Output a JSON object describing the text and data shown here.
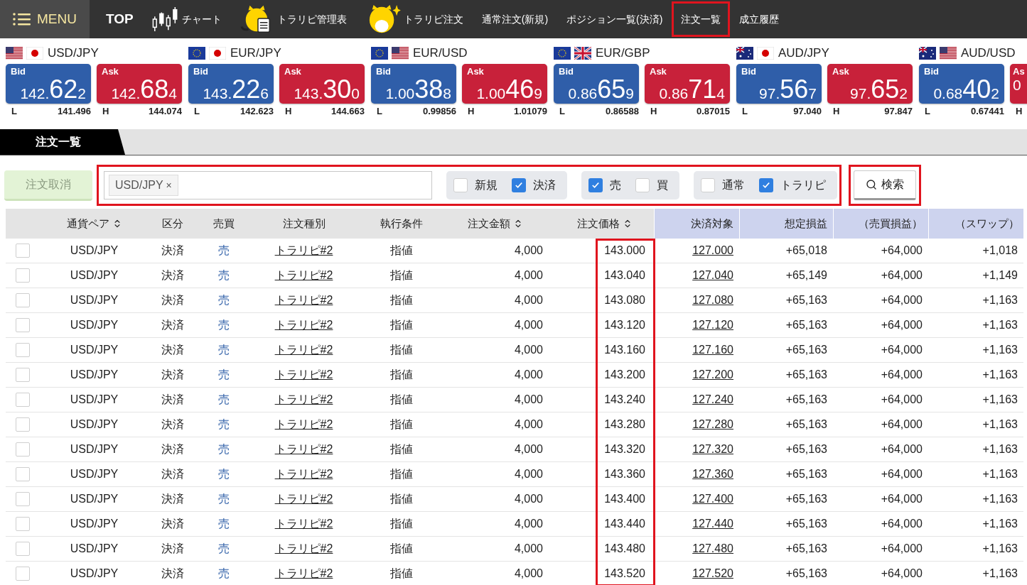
{
  "nav": {
    "items": [
      {
        "kind": "menu",
        "label": "MENU",
        "highlighted": false
      },
      {
        "kind": "bold",
        "label": "TOP",
        "highlighted": false
      },
      {
        "kind": "chart",
        "label": "チャート",
        "highlighted": false
      },
      {
        "kind": "tiger-sheet",
        "label": "トラリピ管理表",
        "highlighted": false
      },
      {
        "kind": "tiger",
        "label": "トラリピ注文",
        "highlighted": false
      },
      {
        "kind": "text",
        "label": "通常注文(新規)",
        "highlighted": false
      },
      {
        "kind": "text",
        "label": "ポジション一覧(決済)",
        "highlighted": false
      },
      {
        "kind": "text",
        "label": "注文一覧",
        "highlighted": true
      },
      {
        "kind": "text",
        "label": "成立履歴",
        "highlighted": false
      }
    ]
  },
  "quotes": [
    {
      "pair": "USD/JPY",
      "bid": {
        "label": "Bid",
        "prefix": "142.",
        "big": "62",
        "small": "2"
      },
      "ask": {
        "label": "Ask",
        "prefix": "142.",
        "big": "68",
        "small": "4"
      },
      "low_label": "L",
      "low": "141.496",
      "high_label": "H",
      "high": "144.074"
    },
    {
      "pair": "EUR/JPY",
      "bid": {
        "label": "Bid",
        "prefix": "143.",
        "big": "22",
        "small": "6"
      },
      "ask": {
        "label": "Ask",
        "prefix": "143.",
        "big": "30",
        "small": "0"
      },
      "low_label": "L",
      "low": "142.623",
      "high_label": "H",
      "high": "144.663"
    },
    {
      "pair": "EUR/USD",
      "bid": {
        "label": "Bid",
        "prefix": "1.00",
        "big": "38",
        "small": "8"
      },
      "ask": {
        "label": "Ask",
        "prefix": "1.00",
        "big": "46",
        "small": "9"
      },
      "low_label": "L",
      "low": "0.99856",
      "high_label": "H",
      "high": "1.01079"
    },
    {
      "pair": "EUR/GBP",
      "bid": {
        "label": "Bid",
        "prefix": "0.86",
        "big": "65",
        "small": "9"
      },
      "ask": {
        "label": "Ask",
        "prefix": "0.86",
        "big": "71",
        "small": "4"
      },
      "low_label": "L",
      "low": "0.86588",
      "high_label": "H",
      "high": "0.87015"
    },
    {
      "pair": "AUD/JPY",
      "bid": {
        "label": "Bid",
        "prefix": "97.",
        "big": "56",
        "small": "7"
      },
      "ask": {
        "label": "Ask",
        "prefix": "97.",
        "big": "65",
        "small": "2"
      },
      "low_label": "L",
      "low": "97.040",
      "high_label": "H",
      "high": "97.847"
    },
    {
      "pair": "AUD/USD",
      "bid": {
        "label": "Bid",
        "prefix": "0.68",
        "big": "40",
        "small": "2"
      },
      "ask": {
        "label": "As",
        "prefix": "0"
      },
      "low_label": "L",
      "low": "0.67441",
      "high_label": "H"
    }
  ],
  "tab": {
    "label": "注文一覧",
    "selected": true
  },
  "toolbar": {
    "cancel_button": {
      "label": "注文取消",
      "disabled": true
    },
    "filters": {
      "highlighted": true,
      "tag": {
        "label": "USD/JPY",
        "remove": "×"
      },
      "groups": [
        [
          {
            "label": "新規",
            "checked": false
          },
          {
            "label": "決済",
            "checked": true
          }
        ],
        [
          {
            "label": "売",
            "checked": true
          },
          {
            "label": "買",
            "checked": false
          }
        ],
        [
          {
            "label": "通常",
            "checked": false
          },
          {
            "label": "トラリピ",
            "checked": true
          }
        ]
      ]
    },
    "search_button": {
      "label": "検索",
      "highlighted": true
    }
  },
  "table": {
    "price_column_highlighted": true,
    "columns": [
      {
        "label": "通貨ペア",
        "sortable": true,
        "kind": "order"
      },
      {
        "label": "区分",
        "sortable": false,
        "kind": "order"
      },
      {
        "label": "売買",
        "sortable": false,
        "kind": "order"
      },
      {
        "label": "注文種別",
        "sortable": false,
        "kind": "order"
      },
      {
        "label": "執行条件",
        "sortable": false,
        "kind": "order"
      },
      {
        "label": "注文金額",
        "sortable": true,
        "kind": "order"
      },
      {
        "label": "注文価格",
        "sortable": true,
        "kind": "order"
      },
      {
        "label": "決済対象",
        "sortable": false,
        "kind": "settlement"
      },
      {
        "label": "想定損益",
        "sortable": false,
        "kind": "settlement"
      },
      {
        "label": "（売買損益）",
        "sortable": false,
        "kind": "settlement"
      },
      {
        "label": "（スワップ）",
        "sortable": false,
        "kind": "settlement"
      }
    ],
    "rows": [
      {
        "checked": false,
        "cells": [
          "USD/JPY",
          "決済",
          "売",
          "トラリピ#2",
          "指値",
          "4,000",
          "143.000",
          "127.000",
          "+65,018",
          "+64,000",
          "+1,018"
        ]
      },
      {
        "checked": false,
        "cells": [
          "USD/JPY",
          "決済",
          "売",
          "トラリピ#2",
          "指値",
          "4,000",
          "143.040",
          "127.040",
          "+65,149",
          "+64,000",
          "+1,149"
        ]
      },
      {
        "checked": false,
        "cells": [
          "USD/JPY",
          "決済",
          "売",
          "トラリピ#2",
          "指値",
          "4,000",
          "143.080",
          "127.080",
          "+65,163",
          "+64,000",
          "+1,163"
        ]
      },
      {
        "checked": false,
        "cells": [
          "USD/JPY",
          "決済",
          "売",
          "トラリピ#2",
          "指値",
          "4,000",
          "143.120",
          "127.120",
          "+65,163",
          "+64,000",
          "+1,163"
        ]
      },
      {
        "checked": false,
        "cells": [
          "USD/JPY",
          "決済",
          "売",
          "トラリピ#2",
          "指値",
          "4,000",
          "143.160",
          "127.160",
          "+65,163",
          "+64,000",
          "+1,163"
        ]
      },
      {
        "checked": false,
        "cells": [
          "USD/JPY",
          "決済",
          "売",
          "トラリピ#2",
          "指値",
          "4,000",
          "143.200",
          "127.200",
          "+65,163",
          "+64,000",
          "+1,163"
        ]
      },
      {
        "checked": false,
        "cells": [
          "USD/JPY",
          "決済",
          "売",
          "トラリピ#2",
          "指値",
          "4,000",
          "143.240",
          "127.240",
          "+65,163",
          "+64,000",
          "+1,163"
        ]
      },
      {
        "checked": false,
        "cells": [
          "USD/JPY",
          "決済",
          "売",
          "トラリピ#2",
          "指値",
          "4,000",
          "143.280",
          "127.280",
          "+65,163",
          "+64,000",
          "+1,163"
        ]
      },
      {
        "checked": false,
        "cells": [
          "USD/JPY",
          "決済",
          "売",
          "トラリピ#2",
          "指値",
          "4,000",
          "143.320",
          "127.320",
          "+65,163",
          "+64,000",
          "+1,163"
        ]
      },
      {
        "checked": false,
        "cells": [
          "USD/JPY",
          "決済",
          "売",
          "トラリピ#2",
          "指値",
          "4,000",
          "143.360",
          "127.360",
          "+65,163",
          "+64,000",
          "+1,163"
        ]
      },
      {
        "checked": false,
        "cells": [
          "USD/JPY",
          "決済",
          "売",
          "トラリピ#2",
          "指値",
          "4,000",
          "143.400",
          "127.400",
          "+65,163",
          "+64,000",
          "+1,163"
        ]
      },
      {
        "checked": false,
        "cells": [
          "USD/JPY",
          "決済",
          "売",
          "トラリピ#2",
          "指値",
          "4,000",
          "143.440",
          "127.440",
          "+65,163",
          "+64,000",
          "+1,163"
        ]
      },
      {
        "checked": false,
        "cells": [
          "USD/JPY",
          "決済",
          "売",
          "トラリピ#2",
          "指値",
          "4,000",
          "143.480",
          "127.480",
          "+65,163",
          "+64,000",
          "+1,163"
        ]
      },
      {
        "checked": false,
        "cells": [
          "USD/JPY",
          "決済",
          "売",
          "トラリピ#2",
          "指値",
          "4,000",
          "143.520",
          "127.520",
          "+65,163",
          "+64,000",
          "+1,163"
        ]
      }
    ]
  }
}
